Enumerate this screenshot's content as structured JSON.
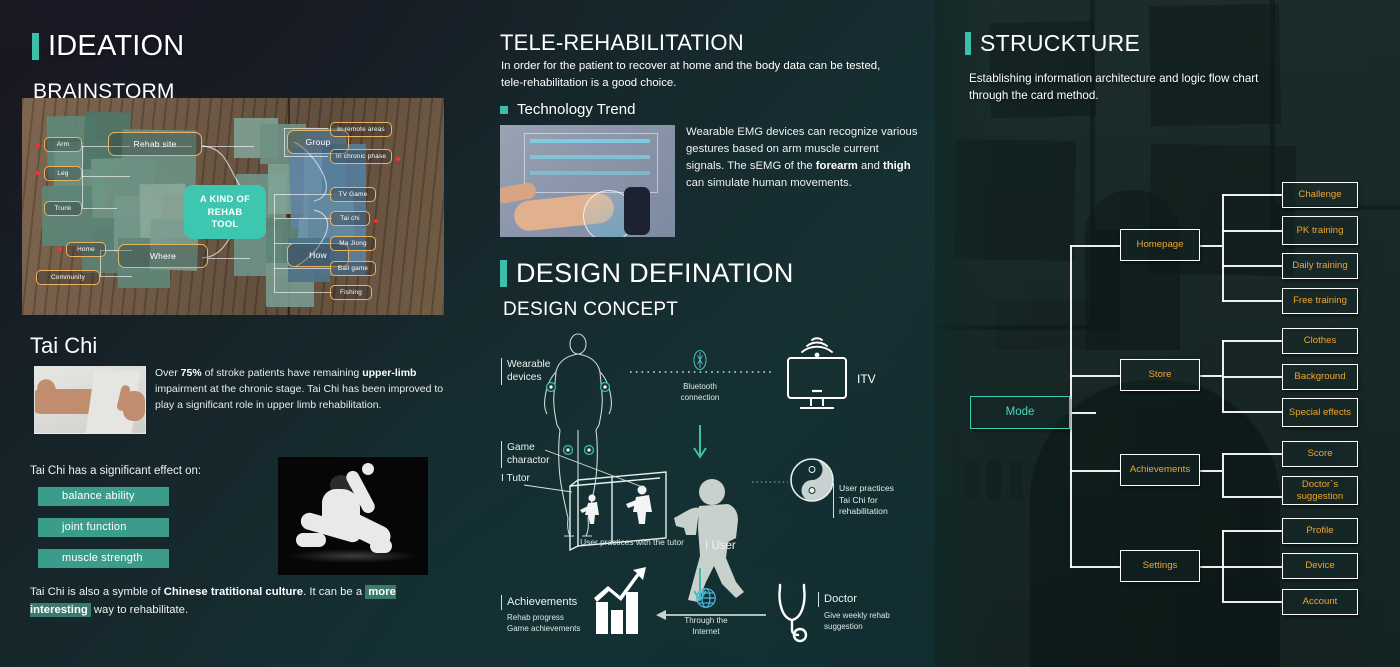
{
  "theme": {
    "accent_teal": "#3bbfa8",
    "node_orange": "#f0a62e",
    "pill_green": "#3c9c8b",
    "bg_dark": "#16262a"
  },
  "column_ideation": {
    "section_title": "IDEATION",
    "subtitle": "BRAINSTORM",
    "mindmap": {
      "center": "A KIND OF\nREHAB TOOL",
      "center_line1": "A KIND OF",
      "center_line2": "REHAB TOOL",
      "left_branches": [
        {
          "label": "Arm",
          "starred": true
        },
        {
          "label": "Leg",
          "starred": true
        },
        {
          "label": "Trunk",
          "starred": false
        },
        {
          "label": "Home",
          "starred": true
        },
        {
          "label": "Community",
          "starred": false
        }
      ],
      "hubs": [
        {
          "label": "Rehab site"
        },
        {
          "label": "Where"
        },
        {
          "label": "Group"
        },
        {
          "label": "How"
        }
      ],
      "right_branches": [
        {
          "label": "In remote areas",
          "starred": false
        },
        {
          "label": "In chronic phase",
          "starred": true
        },
        {
          "label": "TV Game",
          "starred": false
        },
        {
          "label": "Tai chi",
          "starred": true
        },
        {
          "label": "Ma Jiong",
          "starred": false
        },
        {
          "label": "Ball game",
          "starred": false
        },
        {
          "label": "Fishing",
          "starred": false
        }
      ]
    },
    "taichi": {
      "title": "Tai Chi",
      "paragraph_pre": "Over ",
      "paragraph_b1": "75%",
      "paragraph_mid1": " of stroke patients have remaining ",
      "paragraph_b2": "upper-limb",
      "paragraph_mid2": " impairment at the chronic stage.",
      "paragraph_line3": "Tai Chi has been improved to play a significant role in upper limb rehabilitation.",
      "effect_intro": "Tai Chi has a significant effect on:",
      "effects": [
        "balance ability",
        "joint function",
        "muscle strength"
      ],
      "closing_pre": "Tai Chi is also a symble of ",
      "closing_b1": "Chinese tratitional culture",
      "closing_mid": ". It can be a ",
      "closing_b2": "more interesting",
      "closing_end": " way to rehabilitate."
    }
  },
  "column_tele": {
    "section_title": "TELE-REHABILITATION",
    "intro": "In order for the patient to recover at home and the body data can be tested, tele-rehabilitation is a good choice.",
    "tech_trend_label": "Technology Trend",
    "emg_line1": "Wearable EMG devices can recognize various gestures based on arm muscle current signals.",
    "emg_line2_pre": "The sEMG of the ",
    "emg_b1": "forearm",
    "emg_line2_mid": " and ",
    "emg_b2": "thigh",
    "emg_line2_end": " can simulate human movements.",
    "design": {
      "section_title": "DESIGN DEFINATION",
      "subtitle": "DESIGN CONCEPT",
      "label_wearable": "Wearable\ndevices",
      "label_wearable_l1": "Wearable",
      "label_wearable_l2": "devices",
      "label_bluetooth_l1": "Bluetooth",
      "label_bluetooth_l2": "connection",
      "label_itv": "ITV",
      "label_game_char_l1": "Game",
      "label_game_char_l2": "charactor",
      "label_tutor": "I Tutor",
      "caption_tutor": "User practices with the tutor",
      "label_user": "I User",
      "yinyang_l1": "User practices",
      "yinyang_l2": "Tai Chi for",
      "yinyang_l3": "rehabilitation",
      "label_achievements": "Achievements",
      "ach_sub_l1": "Rehab progress",
      "ach_sub_l2": "Game achievements",
      "internet_l1": "Through the",
      "internet_l2": "Internet",
      "label_doctor": "Doctor",
      "doctor_sub_l1": "Give weekly rehab",
      "doctor_sub_l2": "suggestion"
    }
  },
  "column_structure": {
    "section_title": "STRUCKTURE",
    "description": "Establishing information architecture and logic flow chart through the card method.",
    "sitemap": {
      "root": "Mode",
      "branches": [
        {
          "parent": "Homepage",
          "children": [
            "Challenge",
            "PK training",
            "Daily training",
            "Free training"
          ]
        },
        {
          "parent": "Store",
          "children": [
            "Clothes",
            "Background",
            "Special effects"
          ]
        },
        {
          "parent": "Achievements",
          "children": [
            "Score",
            "Doctor`s suggestion"
          ]
        },
        {
          "parent": "Settings",
          "children": [
            "Profile",
            "Device",
            "Account"
          ]
        }
      ]
    }
  }
}
